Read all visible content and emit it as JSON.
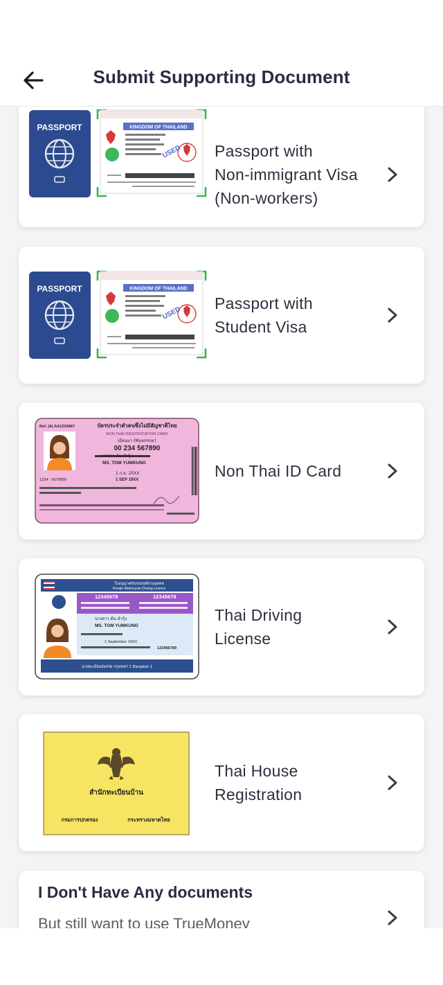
{
  "header": {
    "title": "Submit Supporting Document",
    "back_icon": "arrow-left-icon"
  },
  "documents": [
    {
      "label": "Passport with\nNon-immigrant Visa\n(Non-workers)",
      "thumbnail": "passport-visa-image",
      "thumb_text": {
        "passport": "PASSPORT",
        "kingdom": "KINGDOM OF THAILAND",
        "stamp": "USED"
      }
    },
    {
      "label": "Passport with\nStudent Visa",
      "thumbnail": "passport-visa-image",
      "thumb_text": {
        "passport": "PASSPORT",
        "kingdom": "KINGDOM OF THAILAND",
        "stamp": "USED"
      }
    },
    {
      "label": "Non Thai ID Card",
      "thumbnail": "non-thai-id-card-image",
      "thumb_text": {
        "ref": "Ref. (A) AA1234567",
        "title_th": "บัตรประจำตัวคนซึ่งไม่มีสัญชาติไทย",
        "title_en": "NON THAI IDENTIFICATION CARD",
        "country": "เมียนมา (Myanmar)",
        "number": "00 234 567890",
        "name_th": "นางสาว ต้น ยำกุ้ง",
        "name_en": "MS. TOM YUMKUNG",
        "dob_th": "1 ก.ย. 25XX",
        "dob_en": "1 SEP 19XX",
        "side_no": "1234 - 5678900"
      }
    },
    {
      "label": "Thai Driving\nLicense",
      "thumbnail": "thai-driving-license-image",
      "thumb_text": {
        "header_th": "ใบอนุญาตขับรถยนต์ส่วนบุคคล",
        "header_en": "Private Motorcycle Driving Licence",
        "number": "12345678",
        "no": "12345678",
        "name_th": "นางสาว ต้น ยำกุ้ง",
        "name_en": "MS. TOM YUMKUNG",
        "dob": "1 September 19XX",
        "id_no": "123456789",
        "footer": "นายทะเบียนจังหวัด กรุงเทพฯ 1 Bangkok 1"
      }
    },
    {
      "label": "Thai House\nRegistration",
      "thumbnail": "thai-house-registration-image",
      "thumb_text": {
        "title": "สำนักทะเบียนบ้าน",
        "left": "กรมการปกครอง",
        "right": "กระทรวงมหาดไทย"
      }
    }
  ],
  "no_documents": {
    "title": "I Don't Have Any documents",
    "subtitle": "But still want to use TrueMoney"
  },
  "colors": {
    "title": "#2a2c44",
    "passport_blue": "#2c4a8f",
    "id_pink": "#f0b6dc",
    "license_blue": "#2d4f8f",
    "house_yellow": "#f7e462"
  }
}
